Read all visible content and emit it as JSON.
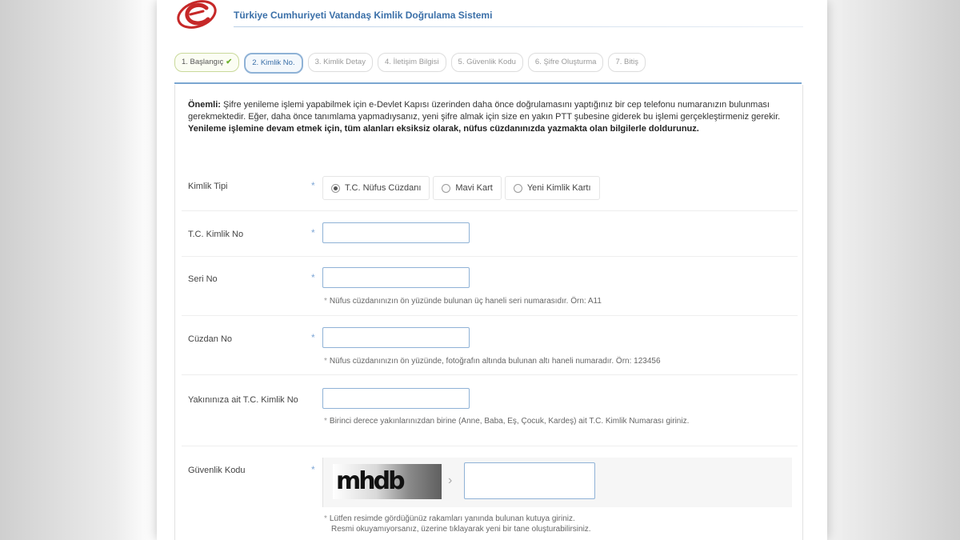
{
  "header": {
    "title": "Türkiye Cumhuriyeti Vatandaş Kimlik Doğrulama Sistemi",
    "brand_color": "#c62828"
  },
  "steps": [
    {
      "label": "1. Başlangıç",
      "state": "done"
    },
    {
      "label": "2. Kimlik No.",
      "state": "active"
    },
    {
      "label": "3. Kimlik Detay",
      "state": "pending"
    },
    {
      "label": "4. İletişim Bilgisi",
      "state": "pending"
    },
    {
      "label": "5. Güvenlik Kodu",
      "state": "pending"
    },
    {
      "label": "6. Şifre Oluşturma",
      "state": "pending"
    },
    {
      "label": "7. Bitiş",
      "state": "pending"
    }
  ],
  "notice": {
    "lead": "Önemli:",
    "text": " Şifre yenileme işlemi yapabilmek için e-Devlet Kapısı üzerinden daha önce doğrulamasını yaptığınız bir cep telefonu numaranızın bulunması gerekmektedir. Eğer, daha önce tanımlama yapmadıysanız, yeni şifre almak için size en yakın PTT şubesine giderek bu işlemi gerçekleştirmeniz gerekir. ",
    "emphasis": "Yenileme işlemine devam etmek için, tüm alanları eksiksiz olarak, nüfus cüzdanınızda yazmakta olan bilgilerle doldurunuz."
  },
  "form": {
    "id_type": {
      "label": "Kimlik Tipi",
      "options": [
        "T.C. Nüfus Cüzdanı",
        "Mavi Kart",
        "Yeni Kimlik Kartı"
      ],
      "selected": "T.C. Nüfus Cüzdanı"
    },
    "tc_no": {
      "label": "T.C. Kimlik No",
      "value": ""
    },
    "serial_no": {
      "label": "Seri No",
      "value": "",
      "hint": "Nüfus cüzdanınızın ön yüzünde bulunan üç haneli seri numarasıdır. Örn: A11"
    },
    "wallet_no": {
      "label": "Cüzdan No",
      "value": "",
      "hint": "Nüfus cüzdanınızın ön yüzünde, fotoğrafın altında bulunan altı haneli numaradır. Örn: 123456"
    },
    "relative_tc": {
      "label": "Yakınınıza ait T.C. Kimlik No",
      "value": "",
      "hint": "Birinci derece yakınlarınızdan birine (Anne, Baba, Eş, Çocuk, Kardeş) ait T.C. Kimlik Numarası giriniz."
    },
    "security_code": {
      "label": "Güvenlik Kodu",
      "captcha_text": "mhdb",
      "value": "",
      "hint_line1": "Lütfen resimde gördüğünüz rakamları yanında bulunan kutuya giriniz.",
      "hint_line2": "Resmi okuyamıyorsanız, üzerine tıklayarak yeni bir tane oluşturabilirsiniz."
    },
    "required_marker": "*",
    "accent_color": "#7aa6d1"
  }
}
